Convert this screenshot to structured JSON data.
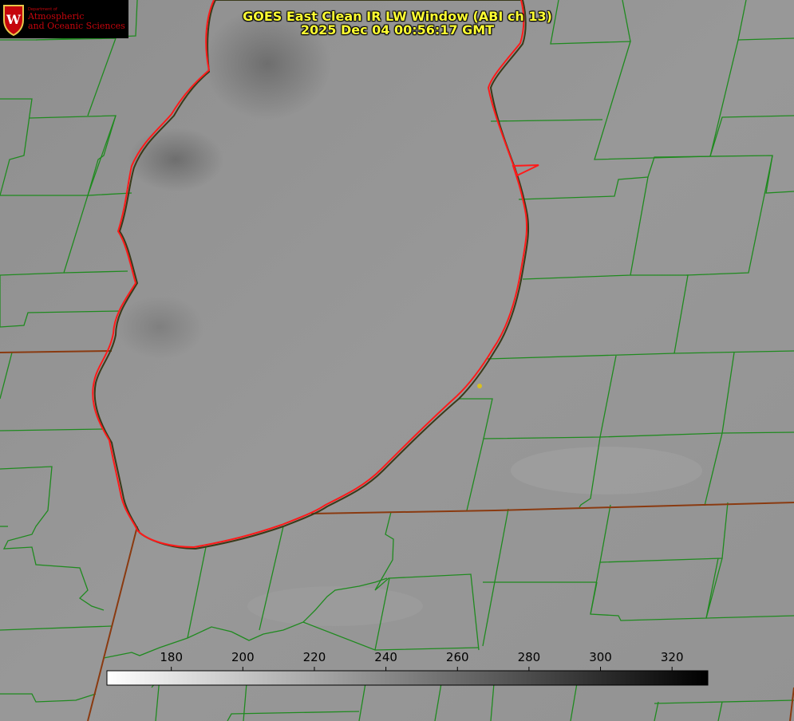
{
  "title": {
    "line1": "GOES East Clean IR LW Window (ABI ch 13)",
    "line2": "2025 Dec 04 00:56:17 GMT"
  },
  "logo": {
    "letter": "W",
    "department": "Department of",
    "line1": "Atmospheric",
    "line2": "and Oceanic Sciences"
  },
  "colorbar": {
    "ticks": [
      180,
      200,
      220,
      240,
      260,
      280,
      300,
      320
    ],
    "min": 162,
    "max": 330,
    "colors": [
      "#ffffff",
      "#000000"
    ]
  },
  "colors": {
    "lake_outline": "#ff1a1a",
    "county_borders": "#1f8a1f",
    "state_borders": "#8a3a10",
    "title_text": "#ffff33",
    "marker": "#d8c020"
  }
}
